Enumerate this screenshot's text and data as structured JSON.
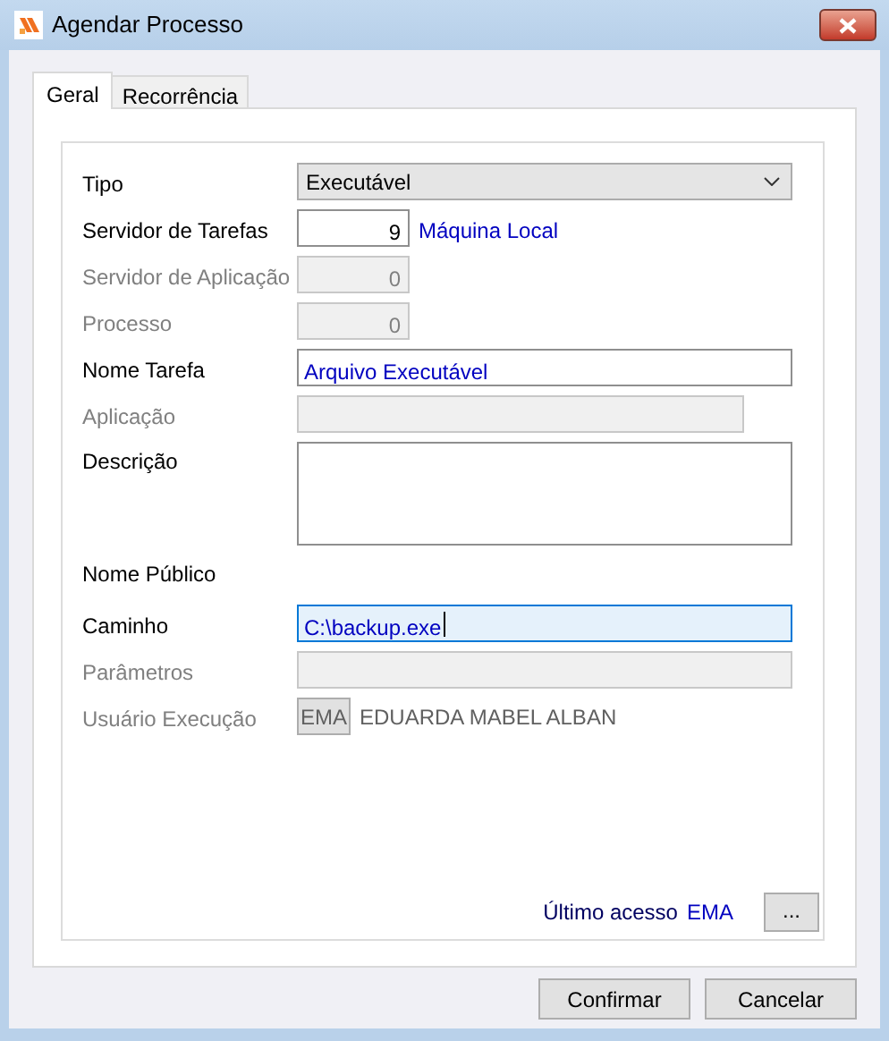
{
  "window": {
    "title": "Agendar Processo"
  },
  "tabs": [
    {
      "label": "Geral",
      "selected": true
    },
    {
      "label": "Recorrência",
      "selected": false
    }
  ],
  "fields": [
    {
      "kind": "select",
      "label": "Tipo",
      "value": "Executável",
      "disabled": false
    },
    {
      "kind": "number",
      "label": "Servidor de Tarefas",
      "value": "9",
      "note": "Máquina Local",
      "disabled": false
    },
    {
      "kind": "number",
      "label": "Servidor de Aplicação",
      "value": "0",
      "disabled": true
    },
    {
      "kind": "number",
      "label": "Processo",
      "value": "0",
      "disabled": true
    },
    {
      "kind": "text",
      "label": "Nome Tarefa",
      "value": "Arquivo Executável",
      "disabled": false,
      "focused": false
    },
    {
      "kind": "short",
      "label": "Aplicação",
      "disabled": true
    },
    {
      "kind": "textarea",
      "label": "Descrição",
      "disabled": false
    },
    {
      "kind": "heading",
      "label": "Nome Público",
      "disabled": false
    },
    {
      "kind": "text",
      "label": "Caminho",
      "value": "C:\\backup.exe",
      "disabled": false,
      "focused": true
    },
    {
      "kind": "text",
      "label": "Parâmetros",
      "disabled": true,
      "focused": false
    },
    {
      "kind": "user",
      "label": "Usuário Execução",
      "code": "EMA",
      "note": "EDUARDA MABEL ALBAN",
      "disabled": true
    }
  ],
  "last_access": {
    "label": "Último acesso",
    "value": "EMA",
    "button": "..."
  },
  "buttons": [
    {
      "label": "Confirmar"
    },
    {
      "label": "Cancelar"
    }
  ]
}
